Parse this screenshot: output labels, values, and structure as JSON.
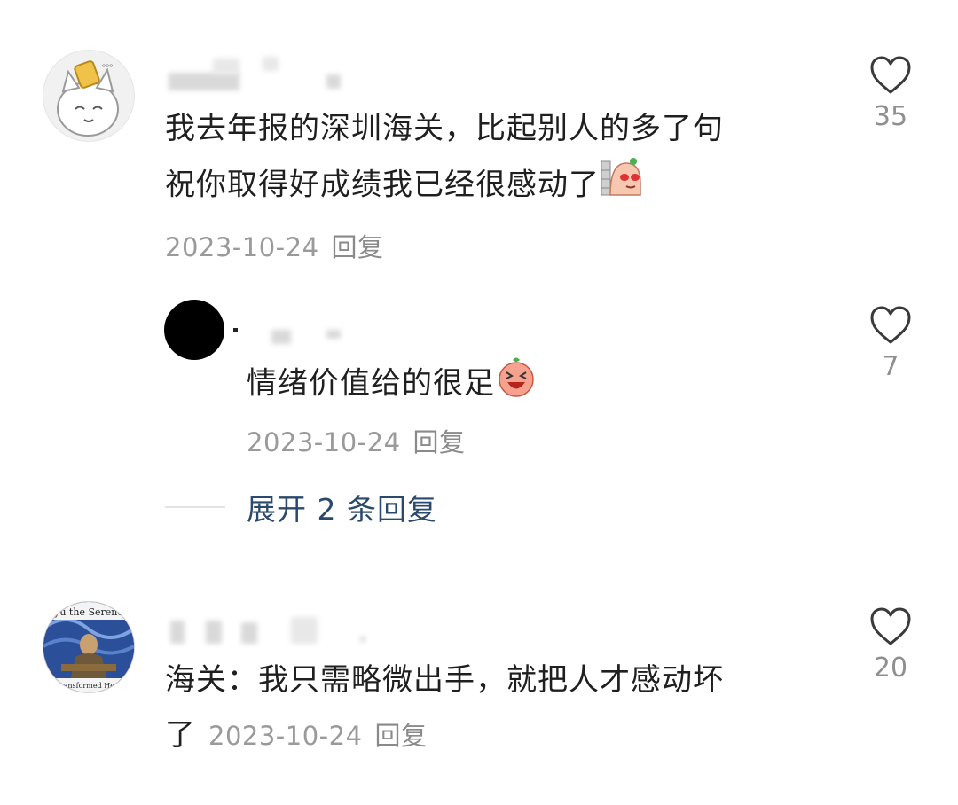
{
  "comments": [
    {
      "avatar": "cat-eating-avatar",
      "text_line1": "我去年报的深圳海关，比起别人的多了句",
      "text_line2": "祝你取得好成绩我已经很感动了",
      "emoji": "peeking-face-emoji",
      "date": "2023-10-24",
      "reply_label": "回复",
      "likes": "35",
      "replies": [
        {
          "avatar": "black-circle-avatar",
          "text": "情绪价值给的很足",
          "emoji": "laughing-face-emoji",
          "date": "2023-10-24",
          "reply_label": "回复",
          "likes": "7"
        }
      ],
      "expand_label": "展开 2 条回复"
    },
    {
      "avatar": "artwork-avatar",
      "avatar_text_top": "yu the Serene",
      "avatar_text_bottom": "Transformed Hero",
      "text_line1": "海关：我只需略微出手，就把人才感动坏",
      "text_line2": "了",
      "date": "2023-10-24",
      "reply_label": "回复",
      "likes": "20"
    }
  ],
  "icons": {
    "like": "heart-outline-icon"
  },
  "colors": {
    "meta": "#9a9a9a",
    "expand": "#2b4a6b",
    "text": "#1f1f1f"
  }
}
